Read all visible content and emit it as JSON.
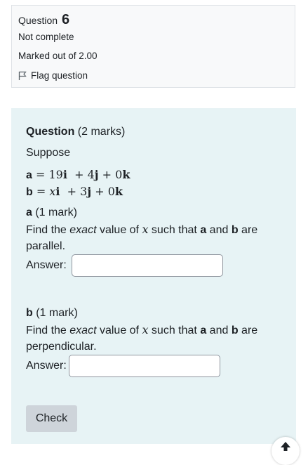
{
  "info": {
    "question_label": "Question",
    "question_number": "6",
    "state": "Not complete",
    "grade": "Marked out of 2.00",
    "flag_label": "Flag question"
  },
  "question": {
    "heading": "Question",
    "marks": "(2 marks)",
    "intro": "Suppose",
    "eq_a": {
      "lhs": "a",
      "eq": " = ",
      "c1": "19",
      "i": "i",
      "plus1": "  + ",
      "c2": "4",
      "j": "j",
      "plus2": " + ",
      "c3": "0",
      "k": "k"
    },
    "eq_b": {
      "lhs": "b",
      "eq": " = ",
      "x": "x",
      "i": "i",
      "plus1": "  + ",
      "c2": "3",
      "j": "j",
      "plus2": " + ",
      "c3": "0",
      "k": "k"
    },
    "part_a": {
      "letter": "a",
      "marks": " (1 mark)",
      "text_1": "Find the ",
      "emph": "exact",
      "text_2": " value of ",
      "var": "x",
      "text_3": " such that ",
      "bold_a": "a",
      "text_and": " and ",
      "bold_b": "b",
      "text_4": " are",
      "line2": "parallel.",
      "answer_label": "Answer:",
      "answer_value": ""
    },
    "part_b": {
      "letter": "b",
      "marks": " (1 mark)",
      "text_1": "Find the ",
      "emph": "exact",
      "text_2": " value of ",
      "var": "x",
      "text_3": " such that ",
      "bold_a": "a",
      "text_and": " and ",
      "bold_b": "b",
      "text_4": " are",
      "line2": "perpendicular.",
      "answer_label": "Answer:",
      "answer_value": ""
    },
    "check_label": "Check"
  },
  "icons": {
    "flag": "flag-icon",
    "back_to_top": "arrow-up-icon"
  }
}
